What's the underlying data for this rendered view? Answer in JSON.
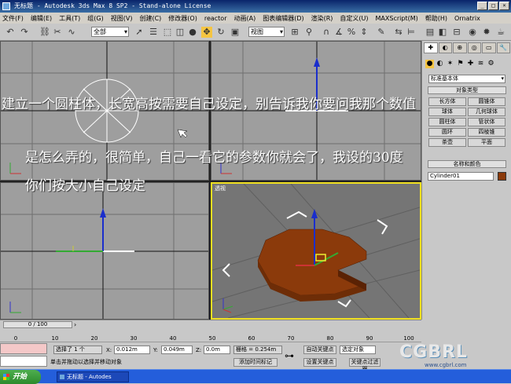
{
  "window": {
    "title": "无标题 - Autodesk 3ds Max 8 SP2 - Stand-alone License",
    "controls": [
      "_",
      "□",
      "×"
    ]
  },
  "menubar": {
    "items": [
      "文件(F)",
      "编辑(E)",
      "工具(T)",
      "组(G)",
      "视图(V)",
      "创建(C)",
      "修改器(O)",
      "reactor",
      "动画(A)",
      "图表编辑器(D)",
      "渲染(R)",
      "自定义(U)",
      "MAXScript(M)",
      "帮助(H)",
      "Ornatrix"
    ]
  },
  "toolbar": {
    "selection_filter": "全部",
    "reference_coord": "视图",
    "icons": [
      "undo-icon",
      "redo-icon",
      "link-icon",
      "unlink-icon",
      "bind-space-warp-icon",
      "select-icon",
      "select-by-name-icon",
      "rect-region-icon",
      "window-crossing-icon",
      "move-icon",
      "rotate-icon",
      "scale-icon",
      "pivot-icon",
      "mirror-icon",
      "align-icon",
      "snap-icon",
      "angle-snap-icon",
      "percent-snap-icon",
      "spinner-snap-icon",
      "named-selection-icon",
      "material-editor-icon",
      "render-scene-icon",
      "quick-render-icon"
    ]
  },
  "viewports": {
    "top_label": "",
    "front_label": "",
    "left_label": "",
    "persp_label": "透视"
  },
  "overlay": {
    "line1": "建立一个圆柱体，长宽高按需要自己设定，别告诉我你要问我那个数值",
    "line2": "是怎么弄的，很简单，自己一看它的参数你就会了，我设的30度",
    "line3": "你们按大小自己设定"
  },
  "command_panel": {
    "tabs": [
      "✚",
      "◐",
      "⊕",
      "◎",
      "▭",
      "🔧"
    ],
    "category": "标准基本体",
    "object_type_title": "对象类型",
    "buttons": [
      "长方体",
      "圆锥体",
      "球体",
      "几何球体",
      "圆柱体",
      "管状体",
      "圆环",
      "四棱锥",
      "茶壶",
      "平面"
    ],
    "name_color_title": "名称和颜色",
    "object_name": "Cylinder01",
    "object_color": "#8b3a0b"
  },
  "timeline": {
    "slider_text": "0 / 100",
    "ticks": [
      "0",
      "10",
      "20",
      "30",
      "40",
      "50",
      "60",
      "70",
      "80",
      "90",
      "100"
    ]
  },
  "status": {
    "selected": "选择了 1 个",
    "prompt": "单击并拖动以选择并移动对象",
    "x_label": "X:",
    "x_value": "0.012m",
    "y_label": "Y:",
    "y_value": "0.049m",
    "z_label": "Z:",
    "z_value": "0.0m",
    "grid": "栅格 = 0.254m",
    "add_time_tag": "添加时间标记",
    "auto_key": "自动关键点",
    "set_key": "设置关键点",
    "selected_object": "选定对象",
    "key_filters": "关键点过滤器"
  },
  "taskbar": {
    "start": "开始",
    "task": "无标题 - Autodes"
  },
  "watermark": {
    "logo": "CGBRL",
    "sub": "www.cgbrl.com"
  }
}
